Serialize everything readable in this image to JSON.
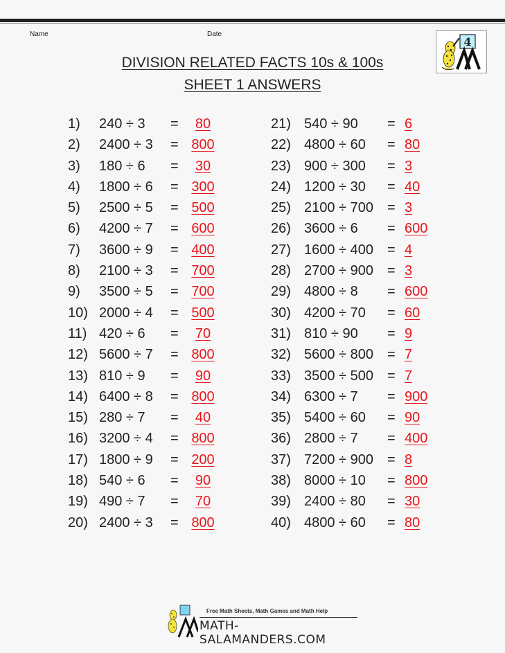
{
  "header": {
    "name_label": "Name",
    "date_label": "Date",
    "title": "DIVISION RELATED FACTS 10s & 100s",
    "subtitle": "SHEET 1 ANSWERS",
    "logo_badge": "4"
  },
  "colors": {
    "answer": "#e8151b",
    "text": "#222222"
  },
  "problems_left": [
    {
      "num": "1)",
      "expr": "240 ÷ 3",
      "eq": "=",
      "ans": "80"
    },
    {
      "num": "2)",
      "expr": "2400 ÷ 3",
      "eq": "=",
      "ans": "800"
    },
    {
      "num": "3)",
      "expr": "180 ÷ 6",
      "eq": "=",
      "ans": "30"
    },
    {
      "num": "4)",
      "expr": "1800 ÷ 6",
      "eq": "=",
      "ans": "300"
    },
    {
      "num": "5)",
      "expr": "2500 ÷ 5",
      "eq": "=",
      "ans": "500"
    },
    {
      "num": "6)",
      "expr": "4200 ÷ 7",
      "eq": "=",
      "ans": "600"
    },
    {
      "num": "7)",
      "expr": "3600 ÷ 9",
      "eq": "=",
      "ans": "400"
    },
    {
      "num": "8)",
      "expr": "2100 ÷ 3",
      "eq": "=",
      "ans": "700"
    },
    {
      "num": "9)",
      "expr": "3500 ÷ 5",
      "eq": "=",
      "ans": "700"
    },
    {
      "num": "10)",
      "expr": "2000 ÷ 4",
      "eq": "=",
      "ans": "500"
    },
    {
      "num": "11)",
      "expr": "420 ÷ 6",
      "eq": "=",
      "ans": "70"
    },
    {
      "num": "12)",
      "expr": "5600 ÷ 7",
      "eq": "=",
      "ans": "800"
    },
    {
      "num": "13)",
      "expr": "810 ÷ 9",
      "eq": "=",
      "ans": "90"
    },
    {
      "num": "14)",
      "expr": "6400 ÷ 8",
      "eq": "=",
      "ans": "800"
    },
    {
      "num": "15)",
      "expr": "280 ÷ 7",
      "eq": "=",
      "ans": "40"
    },
    {
      "num": "16)",
      "expr": "3200 ÷ 4",
      "eq": "=",
      "ans": "800"
    },
    {
      "num": "17)",
      "expr": "1800 ÷ 9",
      "eq": "=",
      "ans": "200"
    },
    {
      "num": "18)",
      "expr": "540 ÷ 6",
      "eq": "=",
      "ans": "90"
    },
    {
      "num": "19)",
      "expr": "490 ÷ 7",
      "eq": "=",
      "ans": "70"
    },
    {
      "num": "20)",
      "expr": "2400 ÷ 3",
      "eq": "=",
      "ans": "800"
    }
  ],
  "problems_right": [
    {
      "num": "21)",
      "expr": "540 ÷ 90",
      "eq": "=",
      "ans": "6"
    },
    {
      "num": "22)",
      "expr": "4800 ÷ 60",
      "eq": "=",
      "ans": "80"
    },
    {
      "num": "23)",
      "expr": "900 ÷ 300",
      "eq": "=",
      "ans": "3"
    },
    {
      "num": "24)",
      "expr": "1200 ÷ 30",
      "eq": "=",
      "ans": "40"
    },
    {
      "num": "25)",
      "expr": "2100 ÷ 700",
      "eq": "=",
      "ans": "3"
    },
    {
      "num": "26)",
      "expr": "3600 ÷ 6",
      "eq": "=",
      "ans": "600"
    },
    {
      "num": "27)",
      "expr": "1600 ÷ 400",
      "eq": "=",
      "ans": "4"
    },
    {
      "num": "28)",
      "expr": "2700 ÷ 900",
      "eq": "=",
      "ans": "3"
    },
    {
      "num": "29)",
      "expr": "4800 ÷ 8",
      "eq": "=",
      "ans": "600"
    },
    {
      "num": "30)",
      "expr": "4200 ÷ 70",
      "eq": "=",
      "ans": "60"
    },
    {
      "num": "31)",
      "expr": "810 ÷ 90",
      "eq": "=",
      "ans": "9"
    },
    {
      "num": "32)",
      "expr": "5600 ÷ 800",
      "eq": "=",
      "ans": "7"
    },
    {
      "num": "33)",
      "expr": "3500 ÷ 500",
      "eq": "=",
      "ans": "7"
    },
    {
      "num": "34)",
      "expr": "6300 ÷ 7",
      "eq": "=",
      "ans": "900"
    },
    {
      "num": "35)",
      "expr": "5400 ÷ 60",
      "eq": "=",
      "ans": "90"
    },
    {
      "num": "36)",
      "expr": "2800 ÷ 7",
      "eq": "=",
      "ans": "400"
    },
    {
      "num": "37)",
      "expr": "7200 ÷ 900",
      "eq": "=",
      "ans": "8"
    },
    {
      "num": "38)",
      "expr": "8000 ÷ 10",
      "eq": "=",
      "ans": "800"
    },
    {
      "num": "39)",
      "expr": "2400 ÷ 80",
      "eq": "=",
      "ans": "30"
    },
    {
      "num": "40)",
      "expr": "4800 ÷ 60",
      "eq": "=",
      "ans": "80"
    }
  ],
  "footer": {
    "tagline": "Free Math Sheets, Math Games and Math Help",
    "brand": "MATH-SALAMANDERS.COM"
  }
}
